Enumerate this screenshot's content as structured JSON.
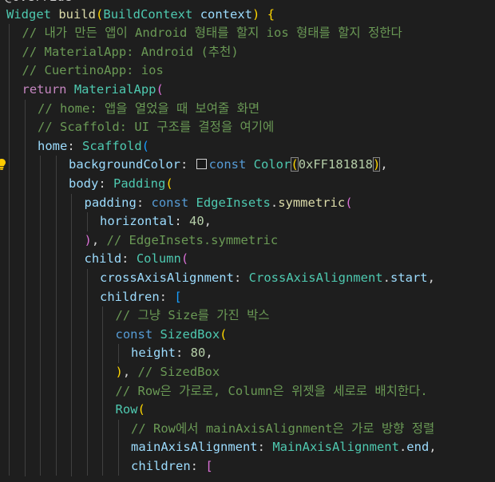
{
  "editor": {
    "language": "dart",
    "background": "#1e1e1e",
    "top_partial": "@override",
    "lines": [
      {
        "indent": 0,
        "tokens": [
          {
            "t": "Widget",
            "c": "type"
          },
          {
            "t": " "
          },
          {
            "t": "build",
            "c": "fn"
          },
          {
            "t": "(",
            "c": "br1"
          },
          {
            "t": "BuildContext",
            "c": "type"
          },
          {
            "t": " "
          },
          {
            "t": "context",
            "c": "prop"
          },
          {
            "t": ")",
            "c": "br1"
          },
          {
            "t": " "
          },
          {
            "t": "{",
            "c": "br1"
          }
        ]
      },
      {
        "indent": 1,
        "tokens": [
          {
            "t": "// 내가 만든 앱이 Android 형태를 할지 ios 형태를 할지 정한다",
            "c": "cmt"
          }
        ]
      },
      {
        "indent": 1,
        "tokens": [
          {
            "t": "// MaterialApp: Android (추천)",
            "c": "cmt"
          }
        ]
      },
      {
        "indent": 1,
        "tokens": [
          {
            "t": "// CuertinoApp: ios",
            "c": "cmt"
          }
        ]
      },
      {
        "indent": 1,
        "tokens": [
          {
            "t": "return",
            "c": "kw-ctrl"
          },
          {
            "t": " "
          },
          {
            "t": "MaterialApp",
            "c": "type"
          },
          {
            "t": "(",
            "c": "br2"
          }
        ]
      },
      {
        "indent": 2,
        "tokens": [
          {
            "t": "// home: 앱을 열었을 때 보여줄 화면",
            "c": "cmt"
          }
        ]
      },
      {
        "indent": 2,
        "tokens": [
          {
            "t": "// Scaffold: UI 구조를 결정을 여기에",
            "c": "cmt"
          }
        ]
      },
      {
        "indent": 2,
        "tokens": [
          {
            "t": "home",
            "c": "prop"
          },
          {
            "t": ": "
          },
          {
            "t": "Scaffold",
            "c": "type"
          },
          {
            "t": "(",
            "c": "br3"
          }
        ]
      },
      {
        "indent": 4,
        "tokens": [
          {
            "t": "backgroundColor",
            "c": "prop"
          },
          {
            "t": ": "
          },
          {
            "t": "",
            "c": "swatch"
          },
          {
            "t": "const",
            "c": "kw"
          },
          {
            "t": " "
          },
          {
            "t": "Color",
            "c": "type"
          },
          {
            "t": "(",
            "c": "br1 bmatch"
          },
          {
            "t": "0xFF181818",
            "c": "num"
          },
          {
            "t": ")",
            "c": "br1 bmatch"
          },
          {
            "t": ","
          }
        ]
      },
      {
        "indent": 4,
        "tokens": [
          {
            "t": "body",
            "c": "prop"
          },
          {
            "t": ": "
          },
          {
            "t": "Padding",
            "c": "type"
          },
          {
            "t": "(",
            "c": "br1"
          }
        ]
      },
      {
        "indent": 5,
        "tokens": [
          {
            "t": "padding",
            "c": "prop"
          },
          {
            "t": ": "
          },
          {
            "t": "const",
            "c": "kw"
          },
          {
            "t": " "
          },
          {
            "t": "EdgeInsets",
            "c": "type"
          },
          {
            "t": "."
          },
          {
            "t": "symmetric",
            "c": "fn"
          },
          {
            "t": "(",
            "c": "br2"
          }
        ]
      },
      {
        "indent": 6,
        "tokens": [
          {
            "t": "horizontal",
            "c": "prop"
          },
          {
            "t": ": "
          },
          {
            "t": "40",
            "c": "num"
          },
          {
            "t": ","
          }
        ]
      },
      {
        "indent": 5,
        "tokens": [
          {
            "t": ")",
            "c": "br2"
          },
          {
            "t": ", "
          },
          {
            "t": "// EdgeInsets.symmetric",
            "c": "cmt"
          }
        ]
      },
      {
        "indent": 5,
        "tokens": [
          {
            "t": "child",
            "c": "prop"
          },
          {
            "t": ": "
          },
          {
            "t": "Column",
            "c": "type"
          },
          {
            "t": "(",
            "c": "br2"
          }
        ]
      },
      {
        "indent": 6,
        "tokens": [
          {
            "t": "crossAxisAlignment",
            "c": "prop"
          },
          {
            "t": ": "
          },
          {
            "t": "CrossAxisAlignment",
            "c": "type"
          },
          {
            "t": "."
          },
          {
            "t": "start",
            "c": "prop"
          },
          {
            "t": ","
          }
        ]
      },
      {
        "indent": 6,
        "tokens": [
          {
            "t": "children",
            "c": "prop"
          },
          {
            "t": ": "
          },
          {
            "t": "[",
            "c": "br3"
          }
        ]
      },
      {
        "indent": 7,
        "tokens": [
          {
            "t": "// 그냥 Size를 가진 박스",
            "c": "cmt"
          }
        ]
      },
      {
        "indent": 7,
        "tokens": [
          {
            "t": "const",
            "c": "kw"
          },
          {
            "t": " "
          },
          {
            "t": "SizedBox",
            "c": "type"
          },
          {
            "t": "(",
            "c": "br1"
          }
        ]
      },
      {
        "indent": 8,
        "tokens": [
          {
            "t": "height",
            "c": "prop"
          },
          {
            "t": ": "
          },
          {
            "t": "80",
            "c": "num"
          },
          {
            "t": ","
          }
        ]
      },
      {
        "indent": 7,
        "tokens": [
          {
            "t": ")",
            "c": "br1"
          },
          {
            "t": ", "
          },
          {
            "t": "// SizedBox",
            "c": "cmt"
          }
        ]
      },
      {
        "indent": 7,
        "tokens": [
          {
            "t": "// Row은 가로로, Column은 위젯을 세로로 배치한다.",
            "c": "cmt"
          }
        ]
      },
      {
        "indent": 7,
        "tokens": [
          {
            "t": "Row",
            "c": "type"
          },
          {
            "t": "(",
            "c": "br1"
          }
        ]
      },
      {
        "indent": 8,
        "tokens": [
          {
            "t": "// Row에서 mainAxisAlignment은 가로 방향 정렬",
            "c": "cmt"
          }
        ]
      },
      {
        "indent": 8,
        "tokens": [
          {
            "t": "mainAxisAlignment",
            "c": "prop"
          },
          {
            "t": ": "
          },
          {
            "t": "MainAxisAlignment",
            "c": "type"
          },
          {
            "t": "."
          },
          {
            "t": "end",
            "c": "prop"
          },
          {
            "t": ","
          }
        ]
      },
      {
        "indent": 8,
        "tokens": [
          {
            "t": "children",
            "c": "prop"
          },
          {
            "t": ": "
          },
          {
            "t": "[",
            "c": "br2"
          }
        ]
      }
    ]
  }
}
